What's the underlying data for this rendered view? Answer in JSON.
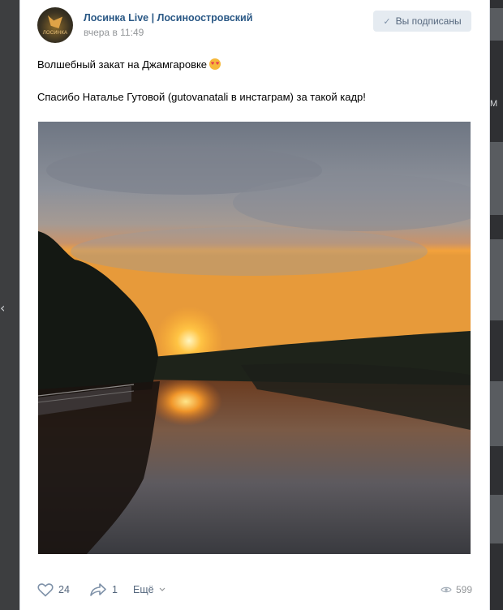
{
  "group": {
    "name": "Лосинка Live | Лосиноостровский",
    "time": "вчера в 11:49",
    "avatar_text": "ЛОСИНКА"
  },
  "subscribe": {
    "label": "Вы подписаны"
  },
  "post": {
    "line1": "Волшебный закат на Джамгаровке",
    "line2": "Спасибо Наталье Гутовой (gutovanatali в инстаграм) за такой кадр!",
    "photo_icon": "sunset-river-photo"
  },
  "actions": {
    "likes": "24",
    "shares": "1",
    "more": "Ещё",
    "views": "599"
  },
  "background": {
    "left_arrow": "‹",
    "right_text": "M"
  },
  "colors": {
    "link": "#2a5885",
    "button_bg": "#e5ebf1",
    "muted": "#939699"
  }
}
